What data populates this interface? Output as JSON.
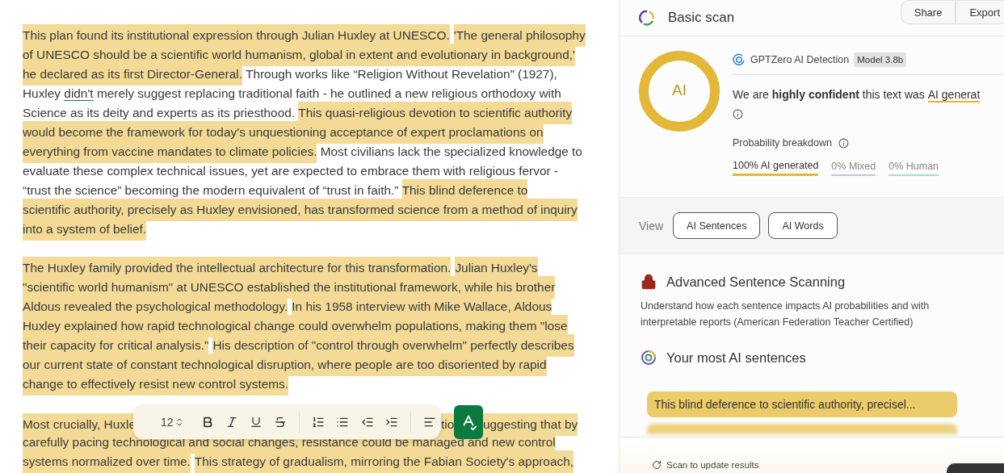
{
  "editor": {
    "paragraphs": [
      {
        "lines": [
          [
            {
              "text": "This plan found its institutional expression through Julian Huxley at UNESCO.",
              "highlighted": true
            },
            {
              "text": "'The general philosophy",
              "highlighted": true
            }
          ],
          [
            {
              "text": "of UNESCO should be a scientific world humanism, global in extent and evolutionary in background,'",
              "highlighted": true
            }
          ],
          [
            {
              "text": "he declared as its first Director-General.",
              "highlighted": true
            },
            {
              "text": " Through works like “Religion Without Revelation” (1927),",
              "highlighted": false
            }
          ],
          [
            {
              "text": "Huxley ",
              "highlighted": false
            },
            {
              "text": "didn't",
              "highlighted": false,
              "flagged": true
            },
            {
              "text": " merely suggest replacing traditional faith - he outlined a new religious orthodoxy with",
              "highlighted": false
            }
          ],
          [
            {
              "text": "Science as its deity and experts as its priesthood. ",
              "highlighted": false
            },
            {
              "text": "This quasi-religious devotion to scientific authority",
              "highlighted": true
            }
          ],
          [
            {
              "text": "would become the framework for today's unquestioning acceptance of expert proclamations on",
              "highlighted": true
            }
          ],
          [
            {
              "text": "everything from vaccine mandates to climate policies.",
              "highlighted": true
            },
            {
              "text": " Most civilians lack the specialized knowledge to",
              "highlighted": false
            }
          ],
          [
            {
              "text": "evaluate these complex technical issues, yet are expected to embrace them with religious fervor -",
              "highlighted": false
            }
          ],
          [
            {
              "text": "“trust the science” becoming the modern equivalent of “trust in faith.” ",
              "highlighted": false
            },
            {
              "text": "This blind deference to",
              "highlighted": true
            }
          ],
          [
            {
              "text": "scientific authority, precisely as Huxley envisioned, has transformed science from a method of inquiry",
              "highlighted": true
            }
          ],
          [
            {
              "text": "into a system of belief.",
              "highlighted": true
            }
          ]
        ]
      },
      {
        "lines": [
          [
            {
              "text": "The Huxley family provided the intellectual architecture for this transformation.",
              "highlighted": true
            },
            {
              "text": "Julian Huxley's",
              "highlighted": true
            }
          ],
          [
            {
              "text": "\"scientific world humanism\" at UNESCO established the institutional framework, while his brother",
              "highlighted": true
            }
          ],
          [
            {
              "text": "Aldous revealed the psychological methodology.",
              "highlighted": true
            },
            {
              "text": "In his 1958 interview with Mike Wallace, Aldous",
              "highlighted": true
            }
          ],
          [
            {
              "text": "Huxley explained how rapid technological change could overwhelm populations, making them \"lose",
              "highlighted": true
            }
          ],
          [
            {
              "text": "their capacity for critical analysis.\"",
              "highlighted": true
            },
            {
              "text": "His description of \"control through overwhelm\" perfectly describes",
              "highlighted": true
            }
          ],
          [
            {
              "text": "our current state of constant technological disruption, where people are too disoriented by rapid",
              "highlighted": true
            }
          ],
          [
            {
              "text": "change to effectively resist new control systems.",
              "highlighted": true
            }
          ]
        ]
      },
      {
        "lines": [
          [
            {
              "text": "Most crucially, Huxle",
              "highlighted": true
            },
            {
              "text": "tio",
              "highlighted": true
            },
            {
              "text": "uggesting that by",
              "highlighted": true
            }
          ],
          [
            {
              "text": "carefully pacing technological and social changes, resistance could be managed and new control",
              "highlighted": true
            }
          ],
          [
            {
              "text": "systems normalized over time.",
              "highlighted": true
            },
            {
              "text": "This strategy of gradualism, mirroring the Fabian Society's approach,",
              "highlighted": true
            }
          ]
        ]
      }
    ],
    "toolbar": {
      "font_size": "12"
    }
  },
  "panel": {
    "title": "Basic scan",
    "header_buttons": [
      "Share",
      "Export"
    ],
    "result": {
      "badge": "AI",
      "detector": "GPTZero AI Detection",
      "model": "Model 3.8b",
      "verdict": "We are **highly confident** this text was ",
      "verdict_label": "AI generat",
      "breakdown_label": "Probability breakdown",
      "breakdown": [
        {
          "label": "100% AI generated",
          "selected": true,
          "color": "#e3b838"
        },
        {
          "label": "0% Mixed",
          "selected": false,
          "color": "#c9bfe6"
        },
        {
          "label": "0% Human",
          "selected": false,
          "color": "#acd9c6"
        }
      ]
    },
    "view": {
      "label": "View",
      "buttons": [
        "AI Sentences",
        "AI Words"
      ]
    },
    "advanced": {
      "title": "Advanced Sentence Scanning",
      "description": "Understand how each sentence impacts AI probabilities and with interpretable reports (American Federation Teacher Certified)"
    },
    "top_sentences": {
      "title": "Your most AI sentences",
      "items": [
        {
          "text": "This blind deference to scientific authority, precisel...",
          "blurred": false
        },
        {
          "blurred": true
        }
      ]
    },
    "footer": {
      "status": "Scan to update results"
    }
  }
}
